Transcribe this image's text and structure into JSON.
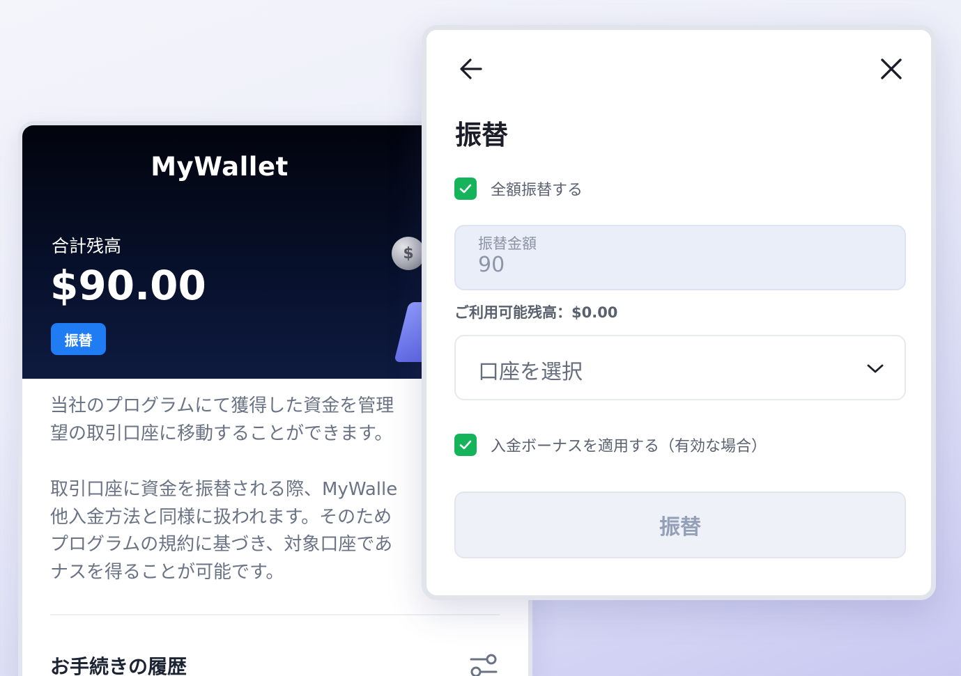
{
  "wallet": {
    "title": "MyWallet",
    "balance_label": "合計残高",
    "balance_value": "$90.00",
    "transfer_button": "振替",
    "coin_symbol": "$",
    "description_p1": [
      "当社のプログラムにて獲得した資金を管理",
      "望の取引口座に移動することができます。"
    ],
    "description_p2": [
      "取引口座に資金を振替される際、MyWalle",
      "他入金方法と同様に扱われます。そのため",
      "プログラムの規約に基づき、対象口座であ",
      "ナスを得ることが可能です。"
    ],
    "history_title": "お手続きの履歴",
    "filter_icon": "sliders-icon"
  },
  "modal": {
    "back_icon": "arrow-left-icon",
    "close_icon": "close-icon",
    "title": "振替",
    "full_transfer_label": "全額振替する",
    "full_transfer_checked": true,
    "amount_label": "振替金額",
    "amount_value": "90",
    "available_balance": "ご利用可能残高：$0.00",
    "account_select_placeholder": "口座を選択",
    "bonus_label": "入金ボーナスを適用する（有効な場合）",
    "bonus_checked": true,
    "submit_label": "振替"
  },
  "colors": {
    "accent_blue": "#1f7cf2",
    "check_green": "#15b35a",
    "hero_dark": "#07102a"
  }
}
